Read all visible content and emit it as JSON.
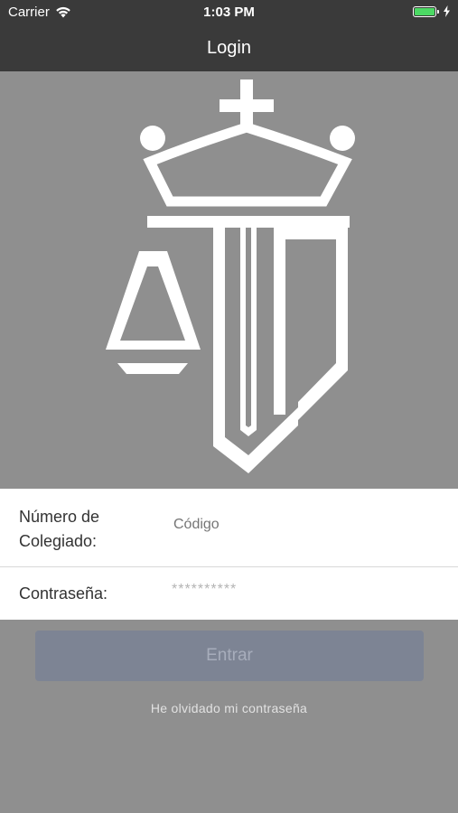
{
  "status_bar": {
    "carrier": "Carrier",
    "time": "1:03 PM",
    "wifi_icon": "wifi-icon",
    "battery_icon": "battery-icon",
    "charging_icon": "bolt-icon",
    "battery_level": 1.0,
    "battery_color": "#4cd964"
  },
  "nav": {
    "title": "Login"
  },
  "logo": {
    "icon": "justice-scales-crown-logo",
    "color": "#ffffff"
  },
  "form": {
    "colegiado_label": "Número de Colegiado:",
    "colegiado_placeholder": "Código",
    "password_label": "Contraseña:",
    "password_value": "**********"
  },
  "actions": {
    "submit_label": "Entrar",
    "forgot_label": "He olvidado mi contraseña"
  },
  "colors": {
    "background": "#8f8f8f",
    "bar": "#3a3a3a",
    "button": "#7d8494"
  }
}
